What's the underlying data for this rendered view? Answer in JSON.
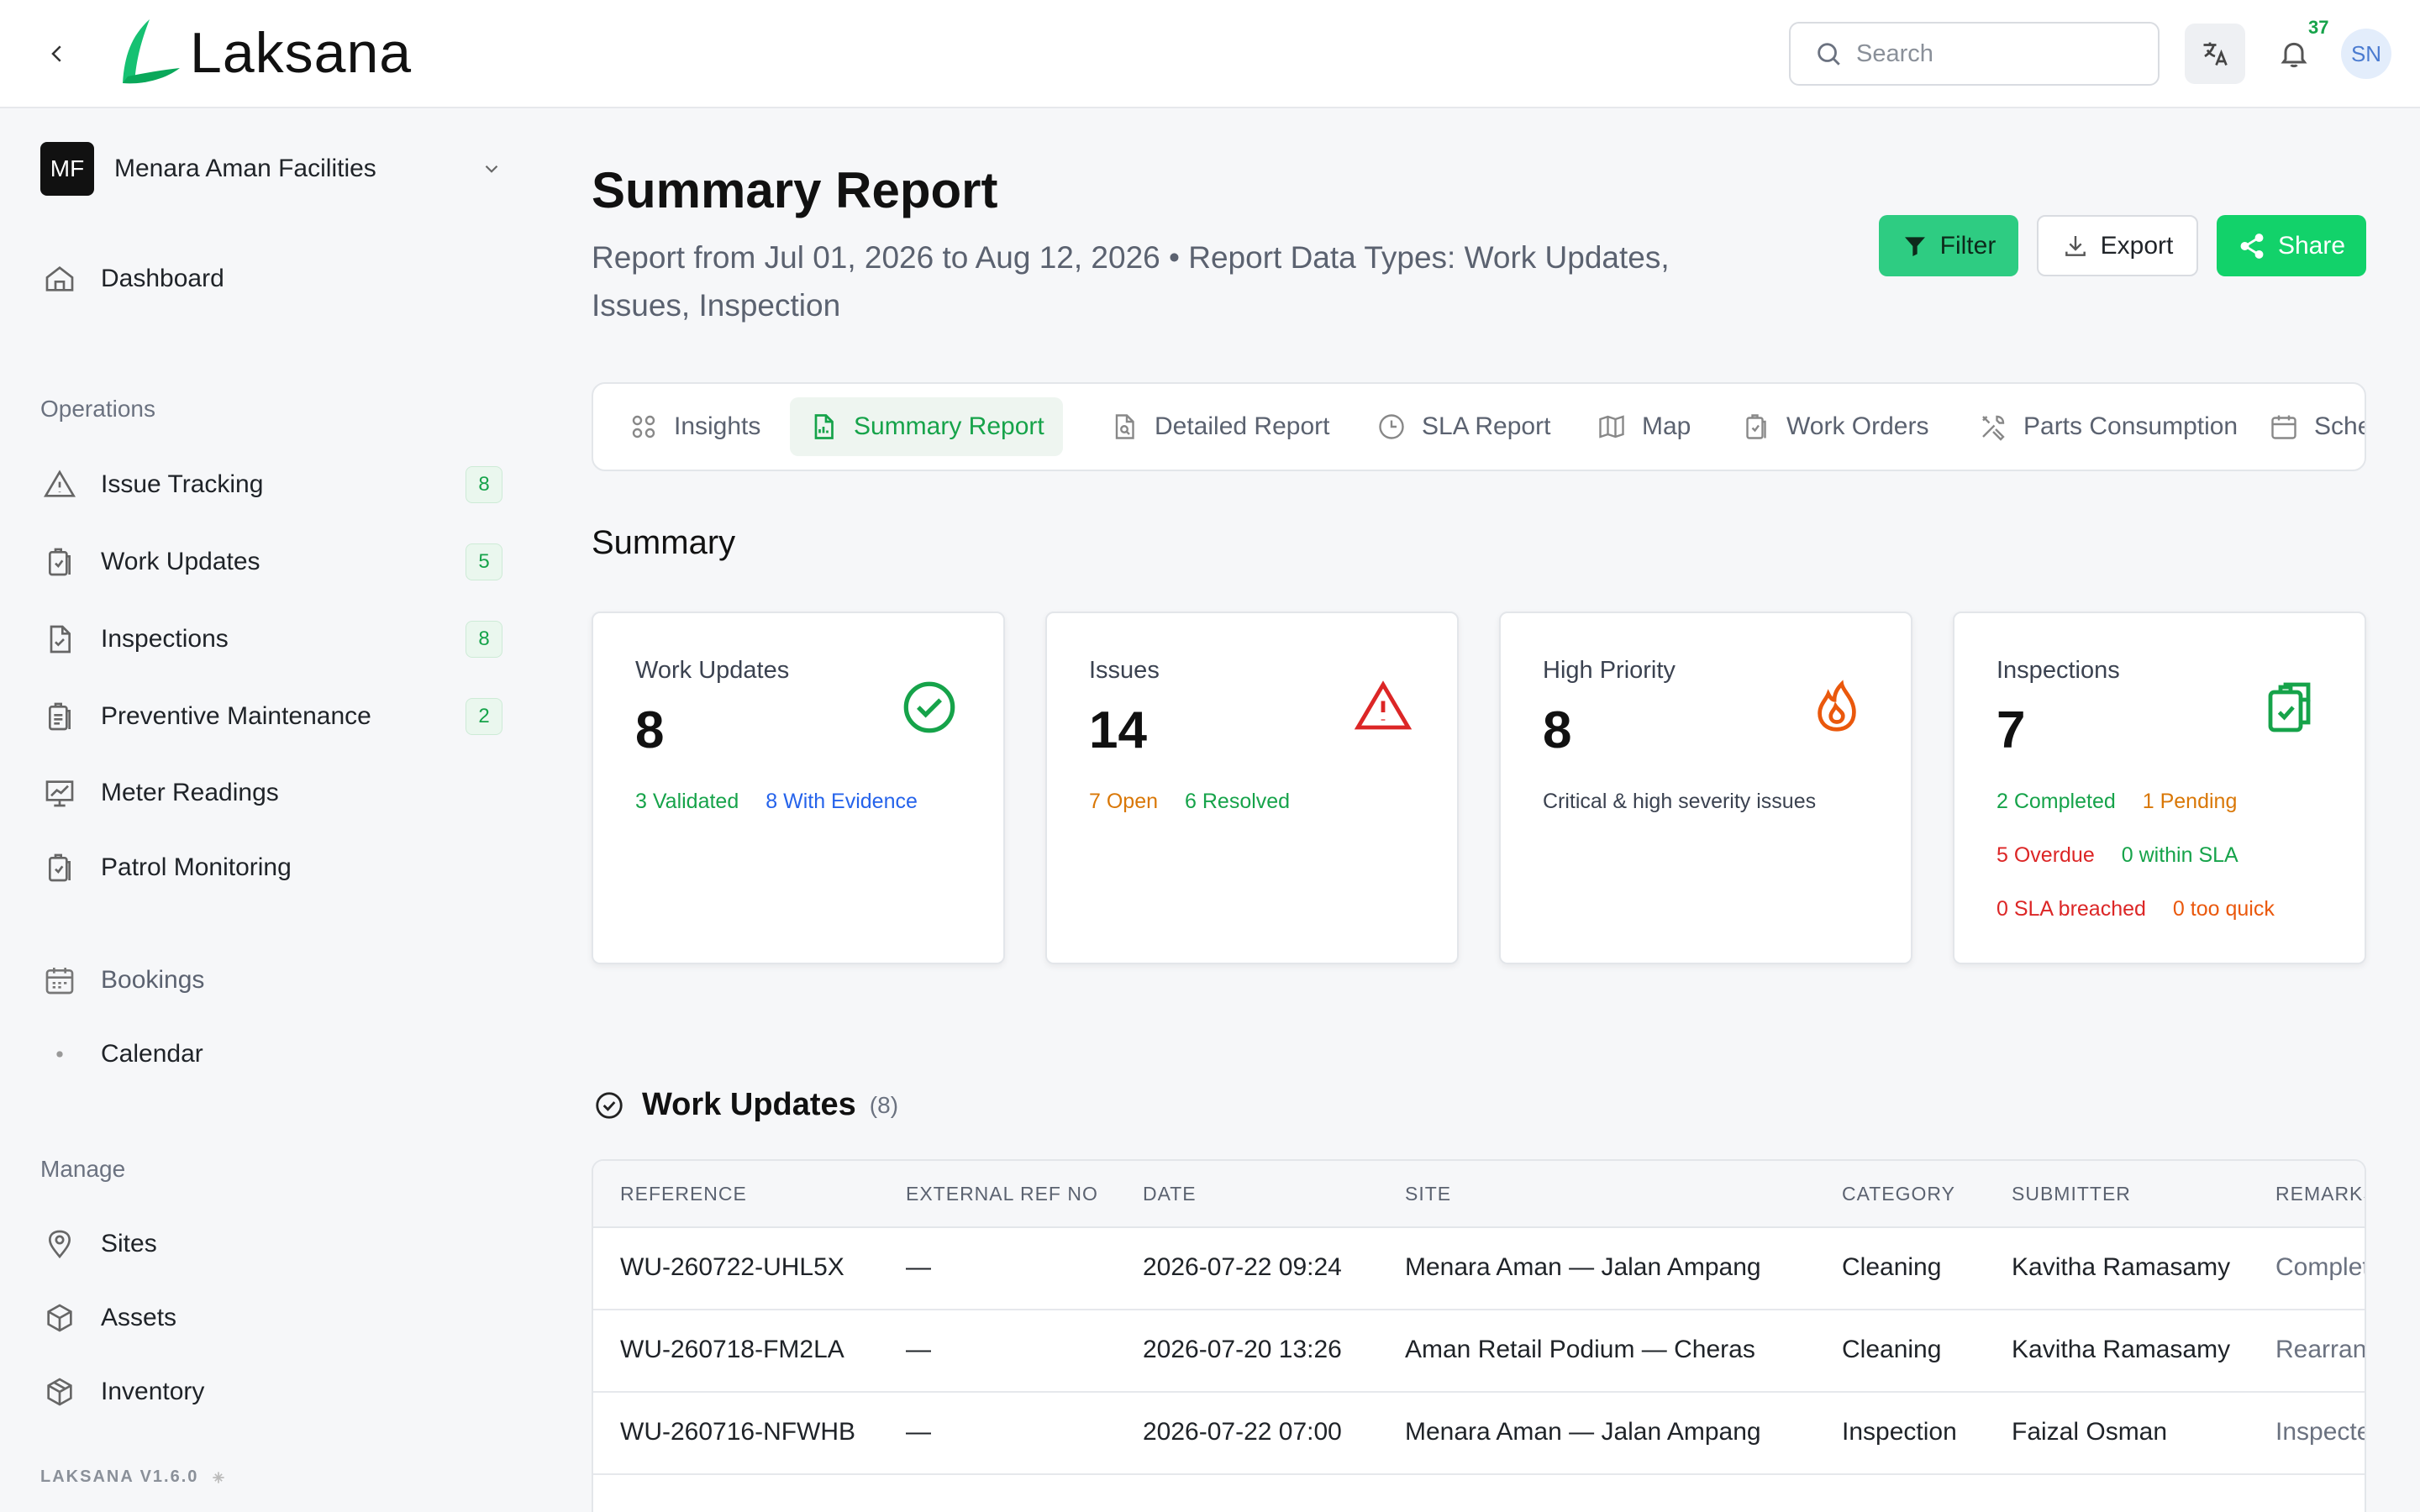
{
  "app": {
    "name": "Laksana",
    "version": "LAKSANA V1.6.0"
  },
  "topbar": {
    "search_placeholder": "Search",
    "notification_count": "37",
    "avatar_initials": "SN"
  },
  "sidebar": {
    "org": {
      "initials": "MF",
      "name": "Menara Aman Facilities"
    },
    "dashboard": "Dashboard",
    "operations_title": "Operations",
    "operations": [
      {
        "label": "Issue Tracking",
        "count": "8",
        "icon": "warning-icon"
      },
      {
        "label": "Work Updates",
        "count": "5",
        "icon": "clipboard-check-icon"
      },
      {
        "label": "Inspections",
        "count": "8",
        "icon": "document-check-icon"
      },
      {
        "label": "Preventive Maintenance",
        "count": "2",
        "icon": "clipboard-list-icon"
      },
      {
        "label": "Meter Readings",
        "icon": "chart-board-icon"
      },
      {
        "label": "Patrol Monitoring",
        "icon": "clipboard-check-icon"
      }
    ],
    "bookings": "Bookings",
    "calendar": "Calendar",
    "manage_title": "Manage",
    "manage": [
      {
        "label": "Sites",
        "icon": "map-pin-icon"
      },
      {
        "label": "Assets",
        "icon": "cube-icon"
      },
      {
        "label": "Inventory",
        "icon": "box-icon"
      }
    ]
  },
  "page": {
    "title": "Summary Report",
    "subtitle": "Report from Jul 01, 2026 to Aug 12, 2026 • Report Data Types: Work Updates, Issues, Inspection",
    "filter_label": "Filter",
    "export_label": "Export",
    "share_label": "Share"
  },
  "tabs": [
    "Insights",
    "Summary Report",
    "Detailed Report",
    "SLA Report",
    "Map",
    "Work Orders",
    "Parts Consumption",
    "Sche"
  ],
  "summary": {
    "title": "Summary",
    "cards": {
      "work_updates": {
        "title": "Work Updates",
        "value": "8",
        "validated": "3 Validated",
        "evidence": "8 With Evidence"
      },
      "issues": {
        "title": "Issues",
        "value": "14",
        "open": "7 Open",
        "resolved": "6 Resolved"
      },
      "high_priority": {
        "title": "High Priority",
        "value": "8",
        "note": "Critical & high severity issues"
      },
      "inspections": {
        "title": "Inspections",
        "value": "7",
        "completed": "2 Completed",
        "pending": "1 Pending",
        "overdue": "5 Overdue",
        "within_sla": "0 within SLA",
        "sla_breached": "0 SLA breached",
        "too_quick": "0 too quick"
      }
    }
  },
  "work_updates_table": {
    "title": "Work Updates",
    "count": "(8)",
    "columns": [
      "REFERENCE",
      "EXTERNAL REF NO",
      "DATE",
      "SITE",
      "CATEGORY",
      "SUBMITTER",
      "REMARKS"
    ],
    "rows": [
      [
        "WU-260722-UHL5X",
        "—",
        "2026-07-22 09:24",
        "Menara Aman — Jalan Ampang",
        "Cleaning",
        "Kavitha Ramasamy",
        "Complet"
      ],
      [
        "WU-260718-FM2LA",
        "—",
        "2026-07-20 13:26",
        "Aman Retail Podium — Cheras",
        "Cleaning",
        "Kavitha Ramasamy",
        "Rearrang"
      ],
      [
        "WU-260716-NFWHB",
        "—",
        "2026-07-22 07:00",
        "Menara Aman — Jalan Ampang",
        "Inspection",
        "Faizal Osman",
        "Inspecte"
      ]
    ]
  },
  "colors": {
    "brand_green": "#16a34a",
    "share_green": "#12d26a",
    "filter_green": "#2ecc82"
  }
}
